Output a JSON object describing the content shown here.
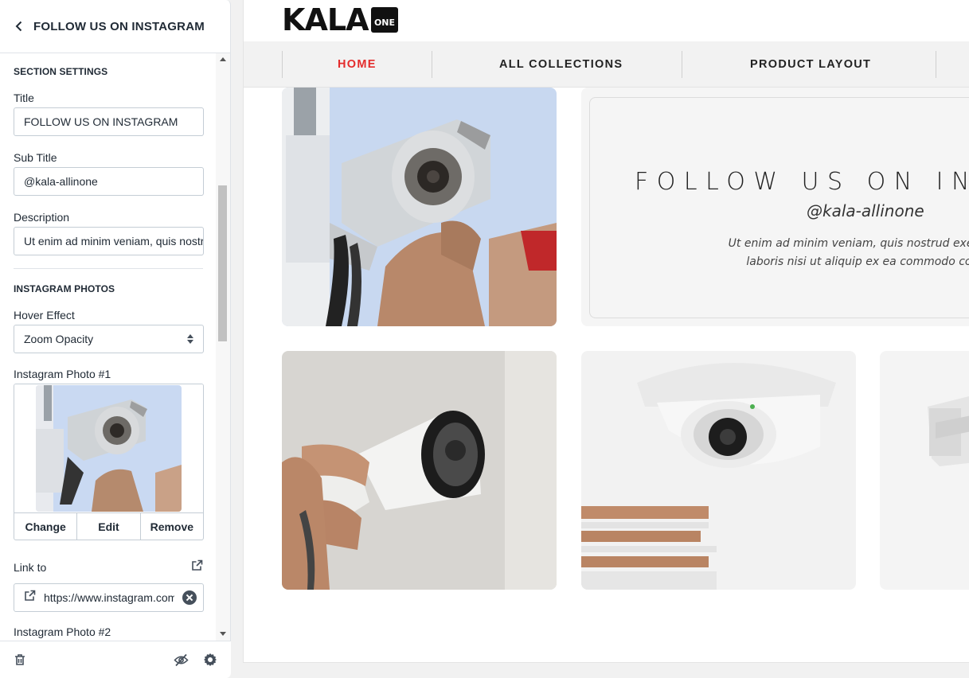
{
  "sidebar": {
    "header_title": "FOLLOW US ON INSTAGRAM",
    "section_settings_heading": "SECTION SETTINGS",
    "title_label": "Title",
    "title_value": "FOLLOW US ON INSTAGRAM",
    "subtitle_label": "Sub Title",
    "subtitle_value": "@kala-allinone",
    "description_label": "Description",
    "description_value": "Ut enim ad minim veniam, quis nostrud",
    "instagram_photos_heading": "INSTAGRAM PHOTOS",
    "hover_effect_label": "Hover Effect",
    "hover_effect_value": "Zoom Opacity",
    "photo1_label": "Instagram Photo #1",
    "photo_actions": {
      "change": "Change",
      "edit": "Edit",
      "remove": "Remove"
    },
    "link_label": "Link to",
    "link_value": "https://www.instagram.com",
    "photo2_label": "Instagram Photo #2"
  },
  "preview": {
    "logo_text": "KALA",
    "logo_badge_text": "ONE",
    "nav": [
      "HOME",
      "ALL COLLECTIONS",
      "PRODUCT LAYOUT"
    ],
    "active_nav": "HOME",
    "follow_title": "FOLLOW US ON INST",
    "follow_subtitle": "@kala-allinone",
    "follow_desc_line1": "Ut enim ad minim veniam, quis nostrud exercitat",
    "follow_desc_line2": "laboris nisi ut aliquip ex ea commodo cons"
  },
  "colors": {
    "accent_red": "#e42c2c",
    "text_dark": "#212b36",
    "border": "#c4cdd5"
  },
  "icons": [
    "chevron-left-icon",
    "trash-icon",
    "eye-off-icon",
    "gear-icon",
    "external-link-icon",
    "clear-icon",
    "select-arrows-icon"
  ]
}
